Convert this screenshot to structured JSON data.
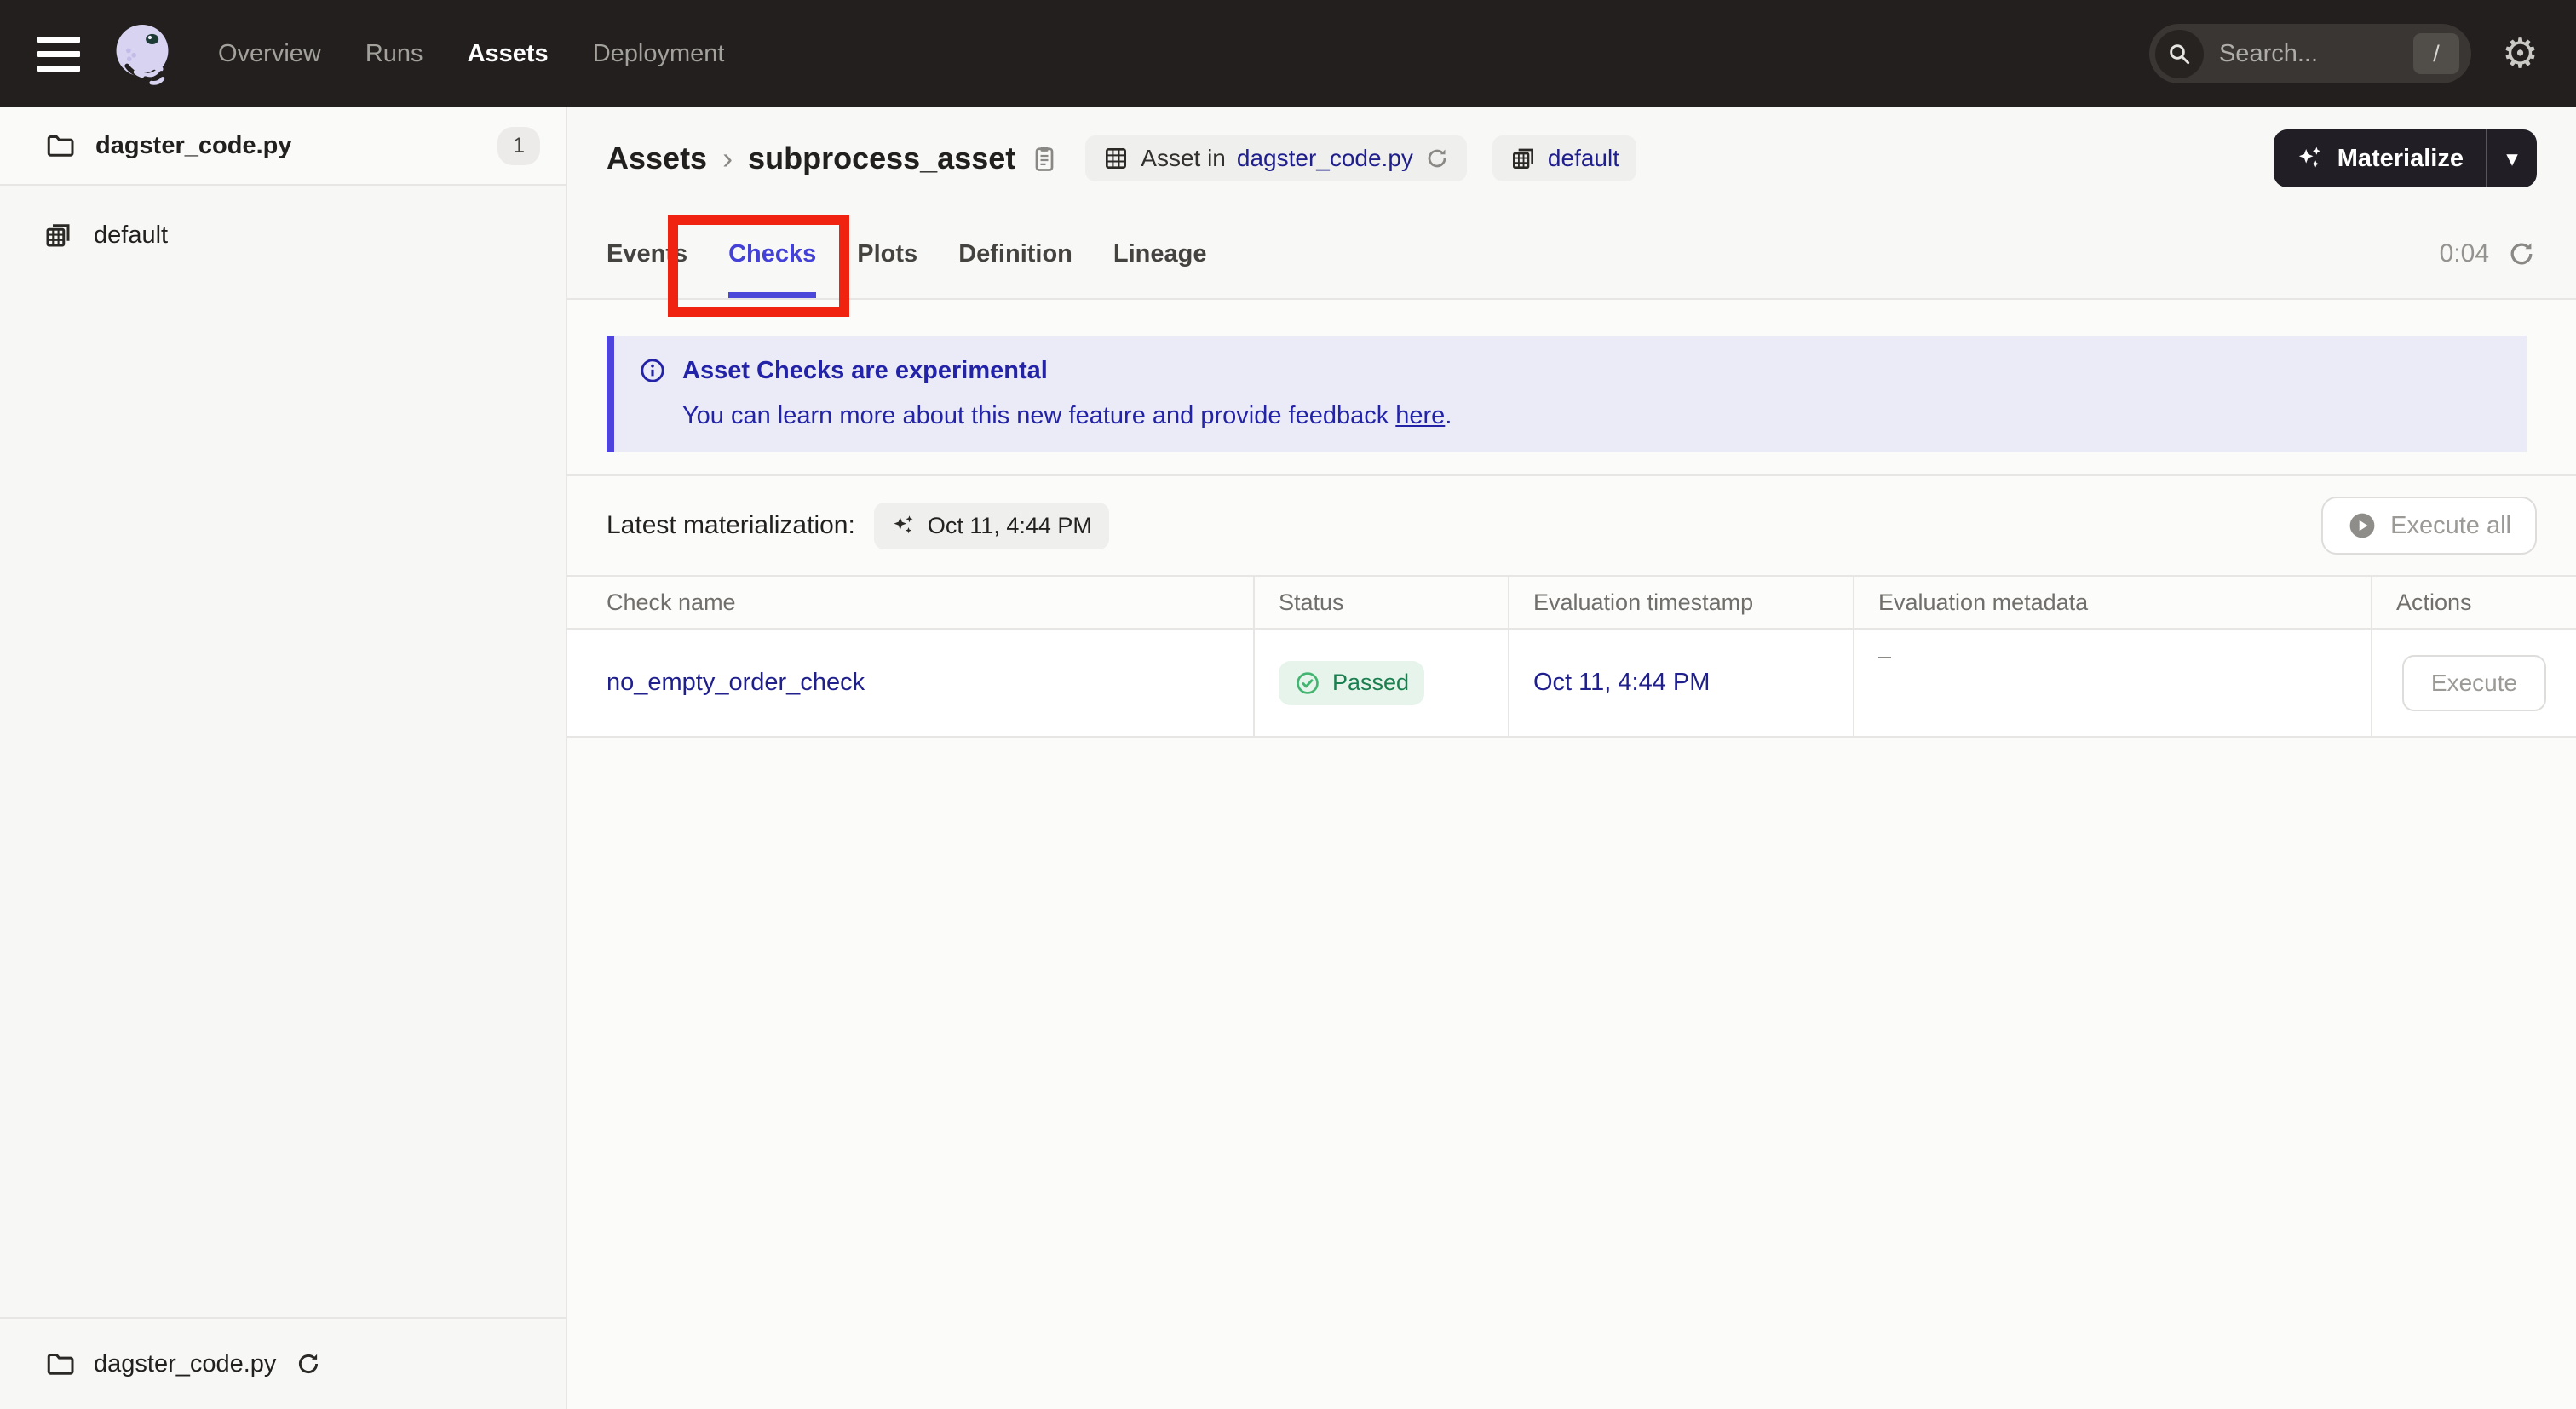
{
  "navbar": {
    "links": [
      {
        "label": "Overview"
      },
      {
        "label": "Runs"
      },
      {
        "label": "Assets"
      },
      {
        "label": "Deployment"
      }
    ],
    "search_placeholder": "Search...",
    "search_shortcut": "/",
    "gear_icon_char": "⚙"
  },
  "sidebar": {
    "code_location": {
      "label": "dagster_code.py",
      "badge": "1"
    },
    "group": {
      "label": "default"
    },
    "footer": {
      "label": "dagster_code.py"
    }
  },
  "page_header": {
    "breadcrumb": {
      "root": "Assets",
      "separator": "›",
      "current": "subprocess_asset"
    },
    "asset_tag": {
      "prefix": "Asset in",
      "link": "dagster_code.py"
    },
    "group_tag": {
      "label": "default"
    },
    "materialize": {
      "label": "Materialize",
      "caret": "▾"
    }
  },
  "tabs": {
    "items": [
      {
        "label": "Events"
      },
      {
        "label": "Checks"
      },
      {
        "label": "Plots"
      },
      {
        "label": "Definition"
      },
      {
        "label": "Lineage"
      }
    ],
    "active": "Checks",
    "refresh_timer": "0:04"
  },
  "banner": {
    "title": "Asset Checks are experimental",
    "body": "You can learn more about this new feature and provide feedback ",
    "link": "here",
    "suffix": "."
  },
  "materialization_bar": {
    "label": "Latest materialization:",
    "timestamp": "Oct 11, 4:44 PM",
    "execute_all": "Execute all"
  },
  "checks_table": {
    "columns": [
      "Check name",
      "Status",
      "Evaluation timestamp",
      "Evaluation metadata",
      "Actions"
    ],
    "rows": [
      {
        "name": "no_empty_order_check",
        "status": "Passed",
        "timestamp": "Oct 11, 4:44 PM",
        "metadata": "–",
        "action": "Execute"
      }
    ]
  },
  "colors": {
    "accent_indigo": "#4F43DD",
    "link_navy": "#20208D",
    "success_green": "#1B8050",
    "annotation_red": "#F02311",
    "navbar_bg": "#221F1E"
  }
}
